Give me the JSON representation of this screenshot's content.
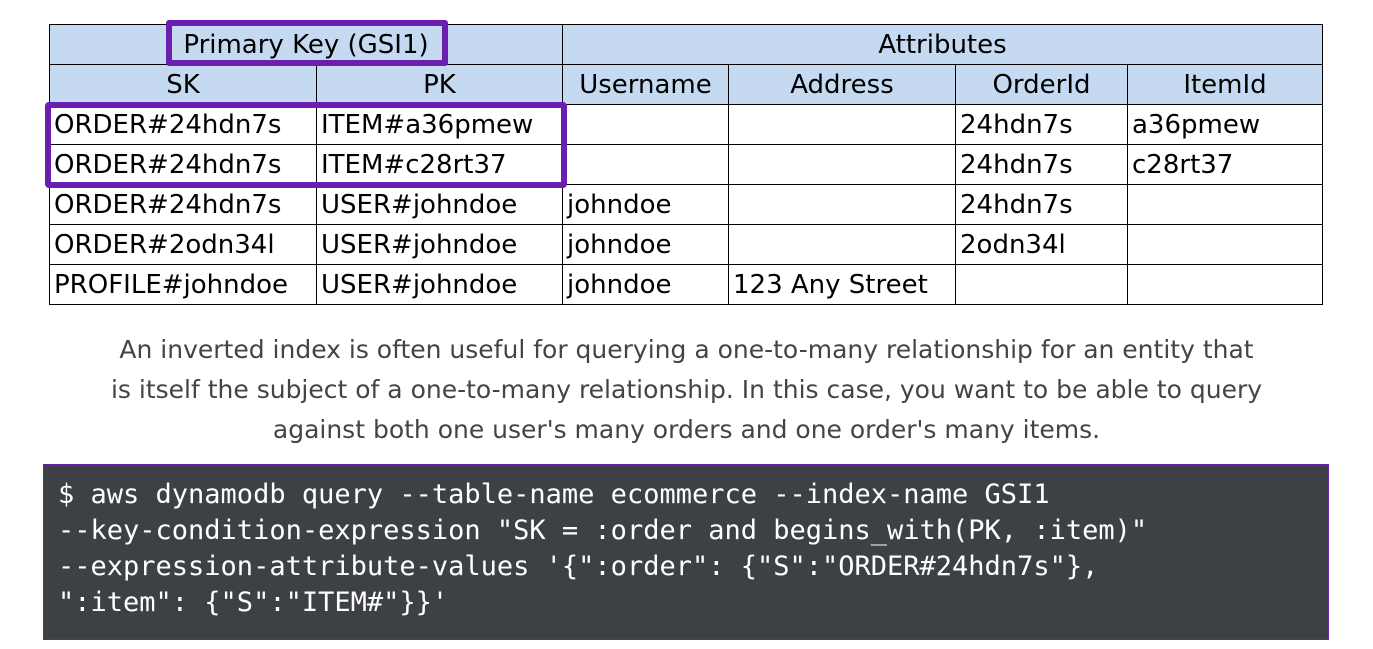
{
  "table": {
    "group_headers": {
      "primary_key": "Primary Key (GSI1)",
      "attributes": "Attributes"
    },
    "columns": [
      "SK",
      "PK",
      "Username",
      "Address",
      "OrderId",
      "ItemId"
    ],
    "rows": [
      [
        "ORDER#24hdn7s",
        "ITEM#a36pmew",
        "",
        "",
        "24hdn7s",
        "a36pmew"
      ],
      [
        "ORDER#24hdn7s",
        "ITEM#c28rt37",
        "",
        "",
        "24hdn7s",
        "c28rt37"
      ],
      [
        "ORDER#24hdn7s",
        "USER#johndoe",
        "johndoe",
        "",
        "24hdn7s",
        ""
      ],
      [
        "ORDER#2odn34l",
        "USER#johndoe",
        "johndoe",
        "",
        "2odn34l",
        ""
      ],
      [
        "PROFILE#johndoe",
        "USER#johndoe",
        "johndoe",
        "123 Any Street",
        "",
        ""
      ]
    ]
  },
  "caption": {
    "line1": "An inverted index is often useful for querying a one-to-many relationship for an entity that",
    "line2": "is itself the subject of a one-to-many relationship. In this case, you want to be able to query",
    "line3": "against both one user's many orders and one order's many items."
  },
  "code": {
    "lines": [
      "$ aws dynamodb query --table-name ecommerce --index-name GSI1",
      "--key-condition-expression \"SK = :order and begins_with(PK, :item)\"",
      "--expression-attribute-values '{\":order\": {\"S\":\"ORDER#24hdn7s\"},",
      "\":item\": {\"S\":\"ITEM#\"}}'"
    ]
  },
  "colors": {
    "header_bg": "#c5daf1",
    "highlight_border": "#6a1fb0",
    "code_bg": "#3d4045"
  }
}
